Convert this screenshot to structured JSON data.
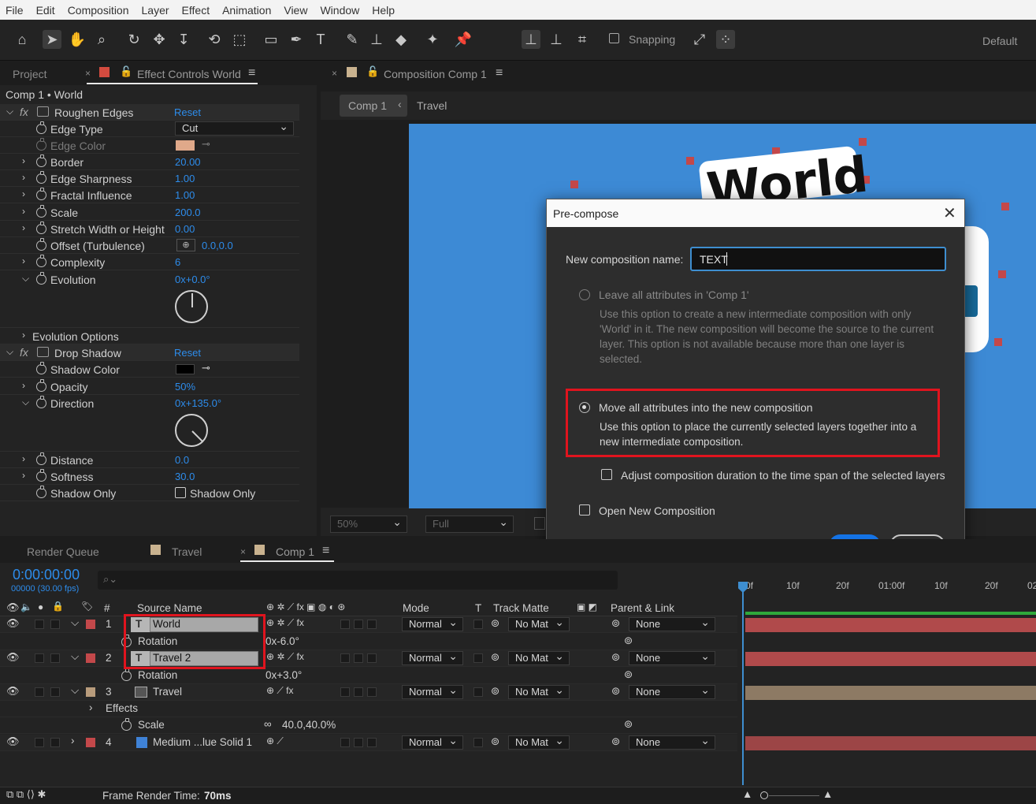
{
  "menu": [
    "File",
    "Edit",
    "Composition",
    "Layer",
    "Effect",
    "Animation",
    "View",
    "Window",
    "Help"
  ],
  "toolbar": {
    "icons": [
      "home-icon",
      "selection-icon",
      "hand-icon",
      "zoom-icon",
      "orbit-icon",
      "move-icon",
      "dolly-icon",
      "rotate-icon",
      "pan-behind-icon",
      "rectangle-icon",
      "pen-icon",
      "type-icon",
      "brush-icon",
      "clone-stamp-icon",
      "eraser-icon",
      "roto-brush-icon",
      "puppet-pin-icon"
    ],
    "snapping_label": "Snapping",
    "workspace_label": "Default"
  },
  "project_panel": {
    "tab_project": "Project",
    "tab_effect_controls": "Effect Controls World",
    "subtitle": "Comp 1 • World"
  },
  "effects": {
    "roughen_edges": {
      "name": "Roughen Edges",
      "reset": "Reset",
      "props": [
        {
          "label": "Edge Type",
          "value": "Cut"
        },
        {
          "label": "Edge Color",
          "value": ""
        },
        {
          "label": "Border",
          "value": "20.00"
        },
        {
          "label": "Edge Sharpness",
          "value": "1.00"
        },
        {
          "label": "Fractal Influence",
          "value": "1.00"
        },
        {
          "label": "Scale",
          "value": "200.0"
        },
        {
          "label": "Stretch Width or Height",
          "value": "0.00"
        },
        {
          "label": "Offset (Turbulence)",
          "value": "0.0,0.0"
        },
        {
          "label": "Complexity",
          "value": "6"
        },
        {
          "label": "Evolution",
          "value": "0x+0.0°"
        },
        {
          "label": "Evolution Options",
          "value": ""
        }
      ],
      "edge_color": "#e0a98a"
    },
    "drop_shadow": {
      "name": "Drop Shadow",
      "reset": "Reset",
      "props": [
        {
          "label": "Shadow Color",
          "value": ""
        },
        {
          "label": "Opacity",
          "value": "50%"
        },
        {
          "label": "Direction",
          "value": "0x+135.0°"
        },
        {
          "label": "Distance",
          "value": "0.0"
        },
        {
          "label": "Softness",
          "value": "30.0"
        },
        {
          "label": "Shadow Only",
          "value": "Shadow Only"
        }
      ],
      "shadow_color": "#000000"
    }
  },
  "composition_panel": {
    "tab": "Composition Comp 1",
    "breadcrumbs": [
      "Comp 1",
      "Travel"
    ],
    "zoom": "50%",
    "resolution": "Full",
    "canvas_color": "#3d8ad5",
    "canvas_text": "World"
  },
  "dialog": {
    "title": "Pre-compose",
    "name_label": "New composition name:",
    "name_value": "TEXT",
    "option1_label": "Leave all attributes in 'Comp 1'",
    "option1_desc": "Use this option to create a new intermediate composition with only 'World' in it. The new composition will become the source to the current layer. This option is not available because more than one layer is selected.",
    "option2_label": "Move all attributes into the new composition",
    "option2_desc": "Use this option to place the currently selected layers together into a new intermediate composition.",
    "adjust_label": "Adjust composition duration to the time span of the selected layers",
    "open_label": "Open New Composition",
    "ok": "OK",
    "cancel": "Cancel"
  },
  "timeline": {
    "tab_render_queue": "Render Queue",
    "tab_travel": "Travel",
    "tab_comp": "Comp 1",
    "timecode": "0:00:00:00",
    "frames": "00000 (30.00 fps)",
    "ruler": [
      "0f",
      "10f",
      "20f",
      "01:00f",
      "10f",
      "20f",
      "02"
    ],
    "headers": {
      "num": "#",
      "source": "Source Name",
      "mode": "Mode",
      "t": "T",
      "track": "Track Matte",
      "parent": "Parent & Link"
    },
    "layers": [
      {
        "num": "1",
        "name": "World",
        "mode": "Normal",
        "matte": "No Mat",
        "parent": "None",
        "color": "#c3484a",
        "sub": {
          "label": "Rotation",
          "value": "0x-6.0°"
        }
      },
      {
        "num": "2",
        "name": "Travel 2",
        "mode": "Normal",
        "matte": "No Mat",
        "parent": "None",
        "color": "#c3484a",
        "sub": {
          "label": "Rotation",
          "value": "0x+3.0°"
        }
      },
      {
        "num": "3",
        "name": "Travel",
        "mode": "Normal",
        "matte": "No Mat",
        "parent": "None",
        "color": "#b89c7c",
        "effects": "Effects",
        "sub": {
          "label": "Scale",
          "value": "40.0,40.0%"
        }
      },
      {
        "num": "4",
        "name": "Medium ...lue Solid 1",
        "mode": "Normal",
        "matte": "No Mat",
        "parent": "None",
        "color": "#c3484a"
      }
    ],
    "footer_label": "Frame Render Time:",
    "footer_value": "70ms"
  }
}
